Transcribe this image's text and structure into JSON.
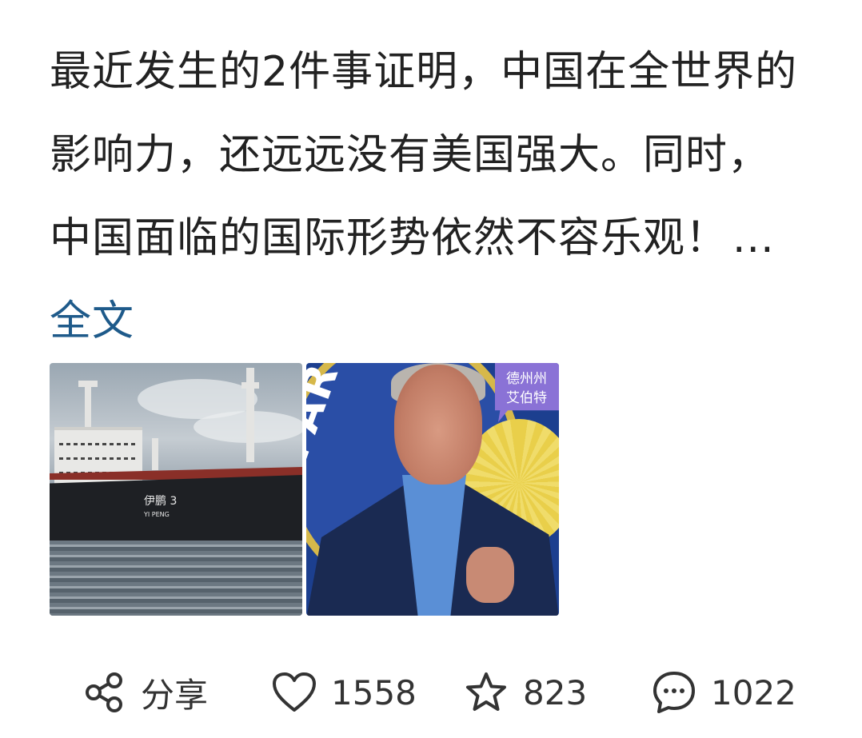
{
  "post": {
    "text": "最近发生的2件事证明，中国在全世界的影响力，还远远没有美国强大。同时，中国面临的国际形势依然不容乐观！",
    "ellipsis": "...",
    "full_text_link": "全文"
  },
  "images": [
    {
      "icon": "cargo-ship-photo",
      "ship_name": "伊鹏 3",
      "ship_name_en": "YI PENG"
    },
    {
      "icon": "governor-press-photo",
      "seal_text": "DEPAR",
      "bubble_lines": [
        "德州州",
        "艾伯特"
      ]
    }
  ],
  "actions": {
    "share": {
      "icon": "share-icon",
      "label": "分享"
    },
    "like": {
      "icon": "heart-icon",
      "count": "1558"
    },
    "favorite": {
      "icon": "star-icon",
      "count": "823"
    },
    "comment": {
      "icon": "comment-icon",
      "count": "1022"
    }
  },
  "colors": {
    "link": "#1e5a8a",
    "text": "#222222",
    "icon": "#333333"
  }
}
